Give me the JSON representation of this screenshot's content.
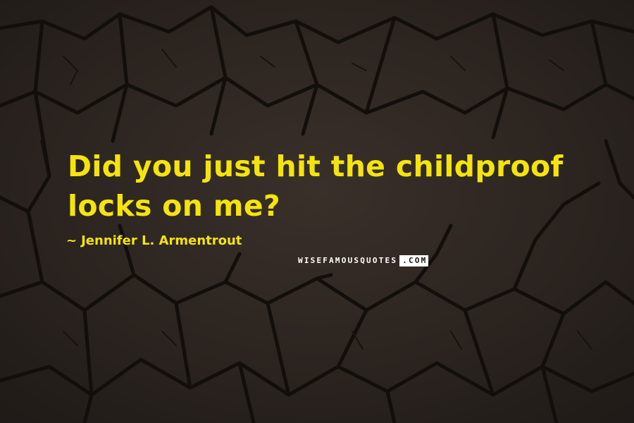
{
  "quote": {
    "text": "Did you just hit the childproof locks on me?"
  },
  "author": {
    "prefix": "~",
    "name": "Jennifer L. Armentrout"
  },
  "watermark": {
    "main": "WISEFAMOUSQUOTES",
    "tld": ".COM"
  },
  "colors": {
    "text": "#f4e40c",
    "background": "#2a231f",
    "cracks": "#120e0b"
  }
}
